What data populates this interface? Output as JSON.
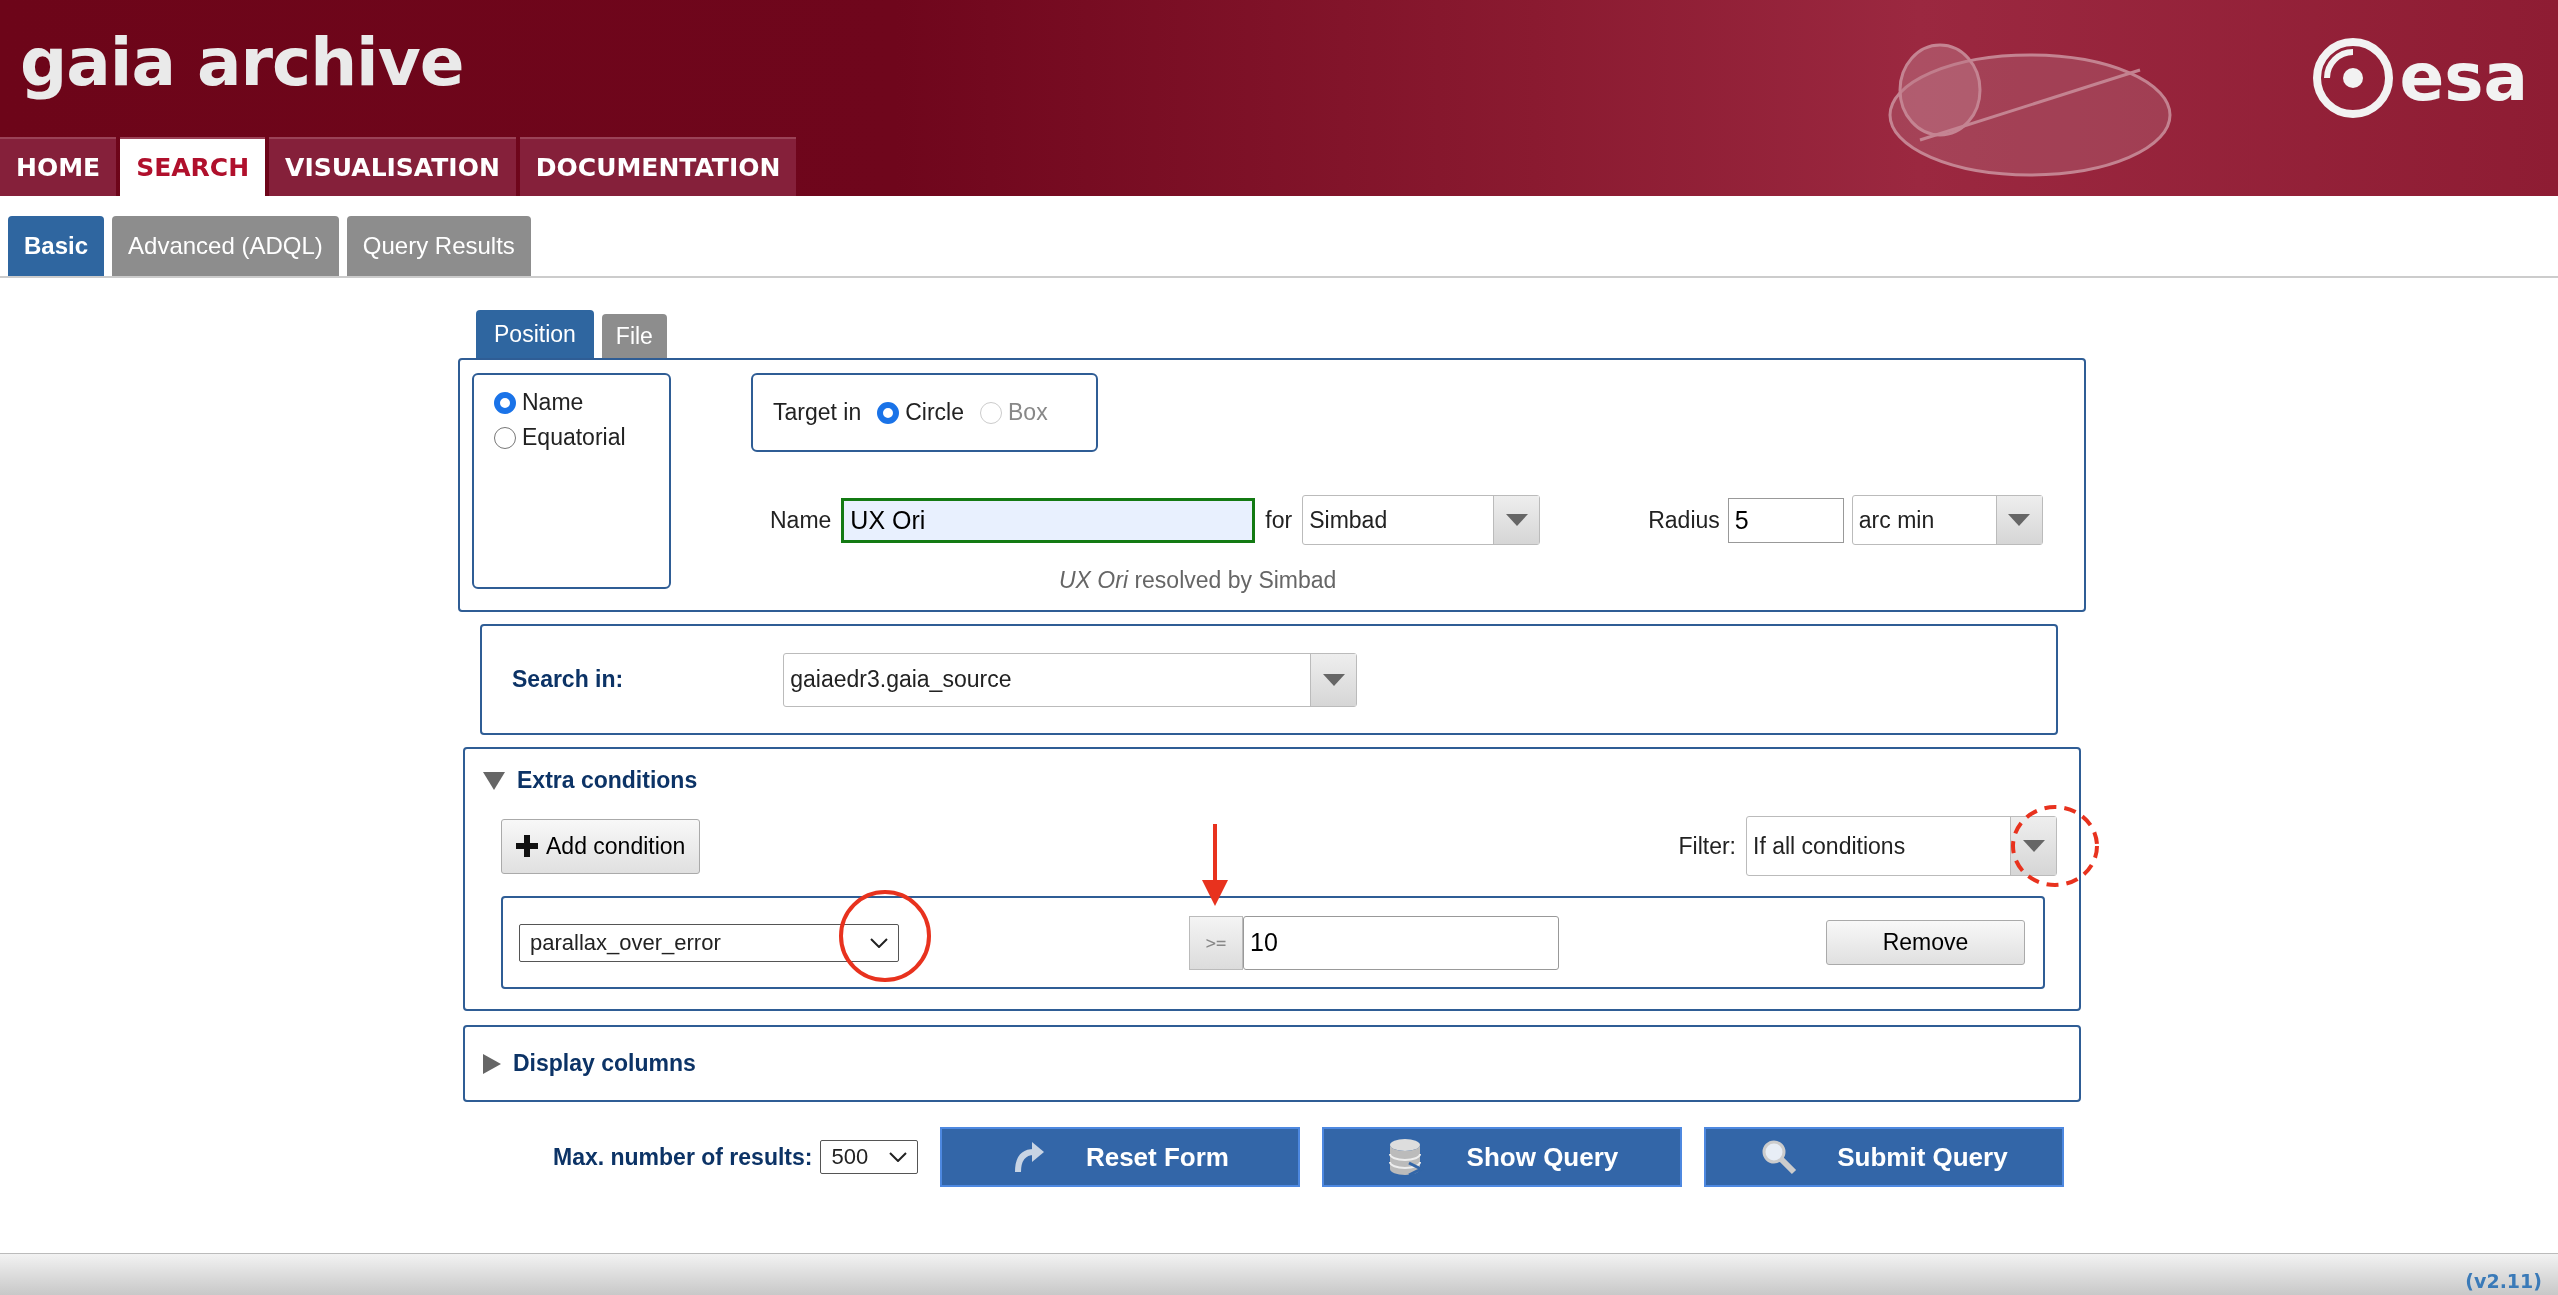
{
  "header": {
    "title": "gaia archive",
    "logo_text": "esa"
  },
  "nav": [
    {
      "label": "HOME",
      "selected": false
    },
    {
      "label": "SEARCH",
      "selected": true
    },
    {
      "label": "VISUALISATION",
      "selected": false
    },
    {
      "label": "DOCUMENTATION",
      "selected": false
    }
  ],
  "subtabs": [
    {
      "label": "Basic",
      "selected": true
    },
    {
      "label": "Advanced (ADQL)",
      "selected": false
    },
    {
      "label": "Query Results",
      "selected": false
    }
  ],
  "position": {
    "tabs": [
      {
        "label": "Position",
        "selected": true
      },
      {
        "label": "File",
        "selected": false
      }
    ],
    "modes": [
      {
        "label": "Name",
        "selected": true
      },
      {
        "label": "Equatorial",
        "selected": false
      }
    ],
    "target": {
      "label": "Target in",
      "shapes": [
        {
          "label": "Circle",
          "selected": true,
          "disabled": false
        },
        {
          "label": "Box",
          "selected": false,
          "disabled": true
        }
      ]
    },
    "name_label": "Name",
    "name_value": "UX Ori",
    "for_label": "for",
    "resolver": "Simbad",
    "radius_label": "Radius",
    "radius_value": "5",
    "radius_unit": "arc min",
    "resolved_note": "*UX Ori* resolved by Simbad"
  },
  "search_in": {
    "label": "Search in:",
    "value": "gaiaedr3.gaia_source"
  },
  "extra_conditions": {
    "title": "Extra conditions",
    "expanded": true,
    "add_button": "Add condition",
    "filter_label": "Filter:",
    "filter_value": "If all conditions",
    "conditions": [
      {
        "column": "parallax_over_error",
        "operator": ">=",
        "value": "10",
        "remove": "Remove"
      }
    ]
  },
  "display_columns": {
    "title": "Display columns",
    "expanded": false
  },
  "max_results": {
    "label": "Max. number of results:",
    "value": "500"
  },
  "buttons": [
    {
      "kind": "reset",
      "label": "Reset Form"
    },
    {
      "kind": "show",
      "label": "Show Query"
    },
    {
      "kind": "submit",
      "label": "Submit Query"
    }
  ],
  "version": "(v2.11)"
}
